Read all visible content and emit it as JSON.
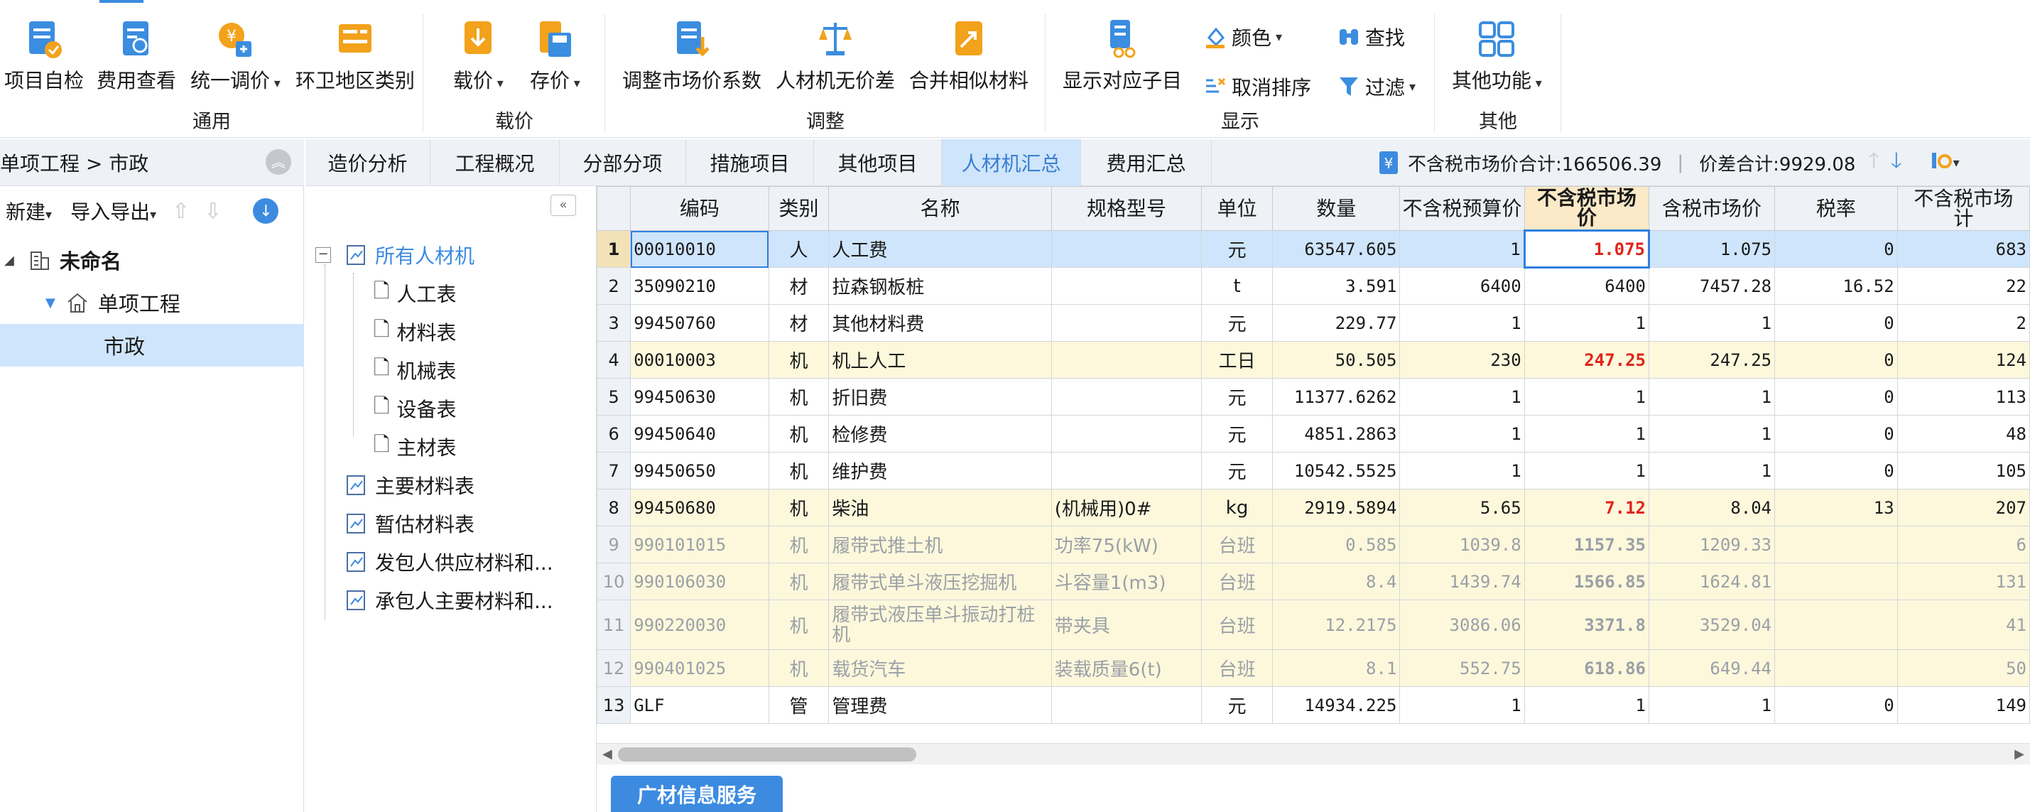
{
  "ribbon": {
    "groups": [
      {
        "label": "通用",
        "buttons": [
          {
            "label": "项目自检",
            "icon": "project-check-icon"
          },
          {
            "label": "费用查看",
            "icon": "fee-view-icon"
          },
          {
            "label": "统一调价",
            "icon": "unified-price-icon",
            "dropdown": true
          },
          {
            "label": "环卫地区类别",
            "icon": "sanitation-region-icon"
          }
        ]
      },
      {
        "label": "载价",
        "buttons": [
          {
            "label": "载价",
            "icon": "load-price-icon",
            "dropdown": true
          },
          {
            "label": "存价",
            "icon": "save-price-icon",
            "dropdown": true
          }
        ]
      },
      {
        "label": "调整",
        "buttons": [
          {
            "label": "调整市场价系数",
            "icon": "adjust-coef-icon"
          },
          {
            "label": "人材机无价差",
            "icon": "no-price-diff-icon"
          },
          {
            "label": "合并相似材料",
            "icon": "merge-material-icon"
          }
        ]
      },
      {
        "label": "显示",
        "buttons": [
          {
            "label": "显示对应子目",
            "icon": "show-subitem-icon"
          }
        ],
        "small": [
          {
            "label": "颜色",
            "icon": "color-icon",
            "dropdown": true
          },
          {
            "label": "查找",
            "icon": "find-icon"
          },
          {
            "label": "取消排序",
            "icon": "cancel-sort-icon"
          },
          {
            "label": "过滤",
            "icon": "filter-icon",
            "dropdown": true
          }
        ]
      },
      {
        "label": "其他",
        "buttons": [
          {
            "label": "其他功能",
            "icon": "other-functions-icon",
            "dropdown": true
          }
        ]
      }
    ],
    "accent_color": "#3c8be0"
  },
  "breadcrumb": {
    "path": "单项工程 > 市政"
  },
  "left_toolbar": {
    "new_label": "新建",
    "import_export_label": "导入导出"
  },
  "project_tree": {
    "root": "未命名",
    "child": "单项工程",
    "leaf": "市政"
  },
  "material_tree": {
    "root": "所有人材机",
    "children": [
      "人工表",
      "材料表",
      "机械表",
      "设备表",
      "主材表"
    ],
    "others": [
      "主要材料表",
      "暂估材料表",
      "发包人供应材料和...",
      "承包人主要材料和..."
    ]
  },
  "tabs": [
    "造价分析",
    "工程概况",
    "分部分项",
    "措施项目",
    "其他项目",
    "人材机汇总",
    "费用汇总"
  ],
  "active_tab": "人材机汇总",
  "summary": {
    "market_total_label": "不含税市场价合计:166506.39",
    "diff_total_label": "价差合计:9929.08"
  },
  "table": {
    "headers": [
      "编码",
      "类别",
      "名称",
      "规格型号",
      "单位",
      "数量",
      "不含税预算价",
      "不含税市场价",
      "含税市场价",
      "税率",
      "不含税市场价合计"
    ],
    "header_display": {
      "h7_line1": "不含税市场",
      "h7_line2": "价",
      "h10_line1": "不含税市场",
      "h10_line2": "计"
    },
    "rows": [
      {
        "n": "1",
        "code": "00010010",
        "type": "人",
        "name": "人工费",
        "spec": "",
        "unit": "元",
        "qty": "63547.605",
        "budget": "1",
        "market": "1.075",
        "tax_market": "1.075",
        "rate": "0",
        "total": "683"
      },
      {
        "n": "2",
        "code": "35090210",
        "type": "材",
        "name": "拉森钢板桩",
        "spec": "",
        "unit": "t",
        "qty": "3.591",
        "budget": "6400",
        "market": "6400",
        "tax_market": "7457.28",
        "rate": "16.52",
        "total": "22"
      },
      {
        "n": "3",
        "code": "99450760",
        "type": "材",
        "name": "其他材料费",
        "spec": "",
        "unit": "元",
        "qty": "229.77",
        "budget": "1",
        "market": "1",
        "tax_market": "1",
        "rate": "0",
        "total": "2"
      },
      {
        "n": "4",
        "code": "00010003",
        "type": "机",
        "name": "机上人工",
        "spec": "",
        "unit": "工日",
        "qty": "50.505",
        "budget": "230",
        "market": "247.25",
        "tax_market": "247.25",
        "rate": "0",
        "total": "124"
      },
      {
        "n": "5",
        "code": "99450630",
        "type": "机",
        "name": "折旧费",
        "spec": "",
        "unit": "元",
        "qty": "11377.6262",
        "budget": "1",
        "market": "1",
        "tax_market": "1",
        "rate": "0",
        "total": "113"
      },
      {
        "n": "6",
        "code": "99450640",
        "type": "机",
        "name": "检修费",
        "spec": "",
        "unit": "元",
        "qty": "4851.2863",
        "budget": "1",
        "market": "1",
        "tax_market": "1",
        "rate": "0",
        "total": "48"
      },
      {
        "n": "7",
        "code": "99450650",
        "type": "机",
        "name": "维护费",
        "spec": "",
        "unit": "元",
        "qty": "10542.5525",
        "budget": "1",
        "market": "1",
        "tax_market": "1",
        "rate": "0",
        "total": "105"
      },
      {
        "n": "8",
        "code": "99450680",
        "type": "机",
        "name": "柴油",
        "spec": "(机械用)0#",
        "unit": "kg",
        "qty": "2919.5894",
        "budget": "5.65",
        "market": "7.12",
        "tax_market": "8.04",
        "rate": "13",
        "total": "207"
      },
      {
        "n": "9",
        "code": "990101015",
        "type": "机",
        "name": "履带式推土机",
        "spec": "功率75(kW)",
        "unit": "台班",
        "qty": "0.585",
        "budget": "1039.8",
        "market": "1157.35",
        "tax_market": "1209.33",
        "rate": "",
        "total": "6"
      },
      {
        "n": "10",
        "code": "990106030",
        "type": "机",
        "name": "履带式单斗液压挖掘机",
        "spec": "斗容量1(m3)",
        "unit": "台班",
        "qty": "8.4",
        "budget": "1439.74",
        "market": "1566.85",
        "tax_market": "1624.81",
        "rate": "",
        "total": "131"
      },
      {
        "n": "11",
        "code": "990220030",
        "type": "机",
        "name": "履带式液压单斗振动打桩机",
        "spec": "带夹具",
        "unit": "台班",
        "qty": "12.2175",
        "budget": "3086.06",
        "market": "3371.8",
        "tax_market": "3529.04",
        "rate": "",
        "total": "41"
      },
      {
        "n": "12",
        "code": "990401025",
        "type": "机",
        "name": "载货汽车",
        "spec": "装载质量6(t)",
        "unit": "台班",
        "qty": "8.1",
        "budget": "552.75",
        "market": "618.86",
        "tax_market": "649.44",
        "rate": "",
        "total": "50"
      },
      {
        "n": "13",
        "code": "GLF",
        "type": "管",
        "name": "管理费",
        "spec": "",
        "unit": "元",
        "qty": "14934.225",
        "budget": "1",
        "market": "1",
        "tax_market": "1",
        "rate": "0",
        "total": "149"
      }
    ]
  },
  "bottom_tab": "广材信息服务"
}
